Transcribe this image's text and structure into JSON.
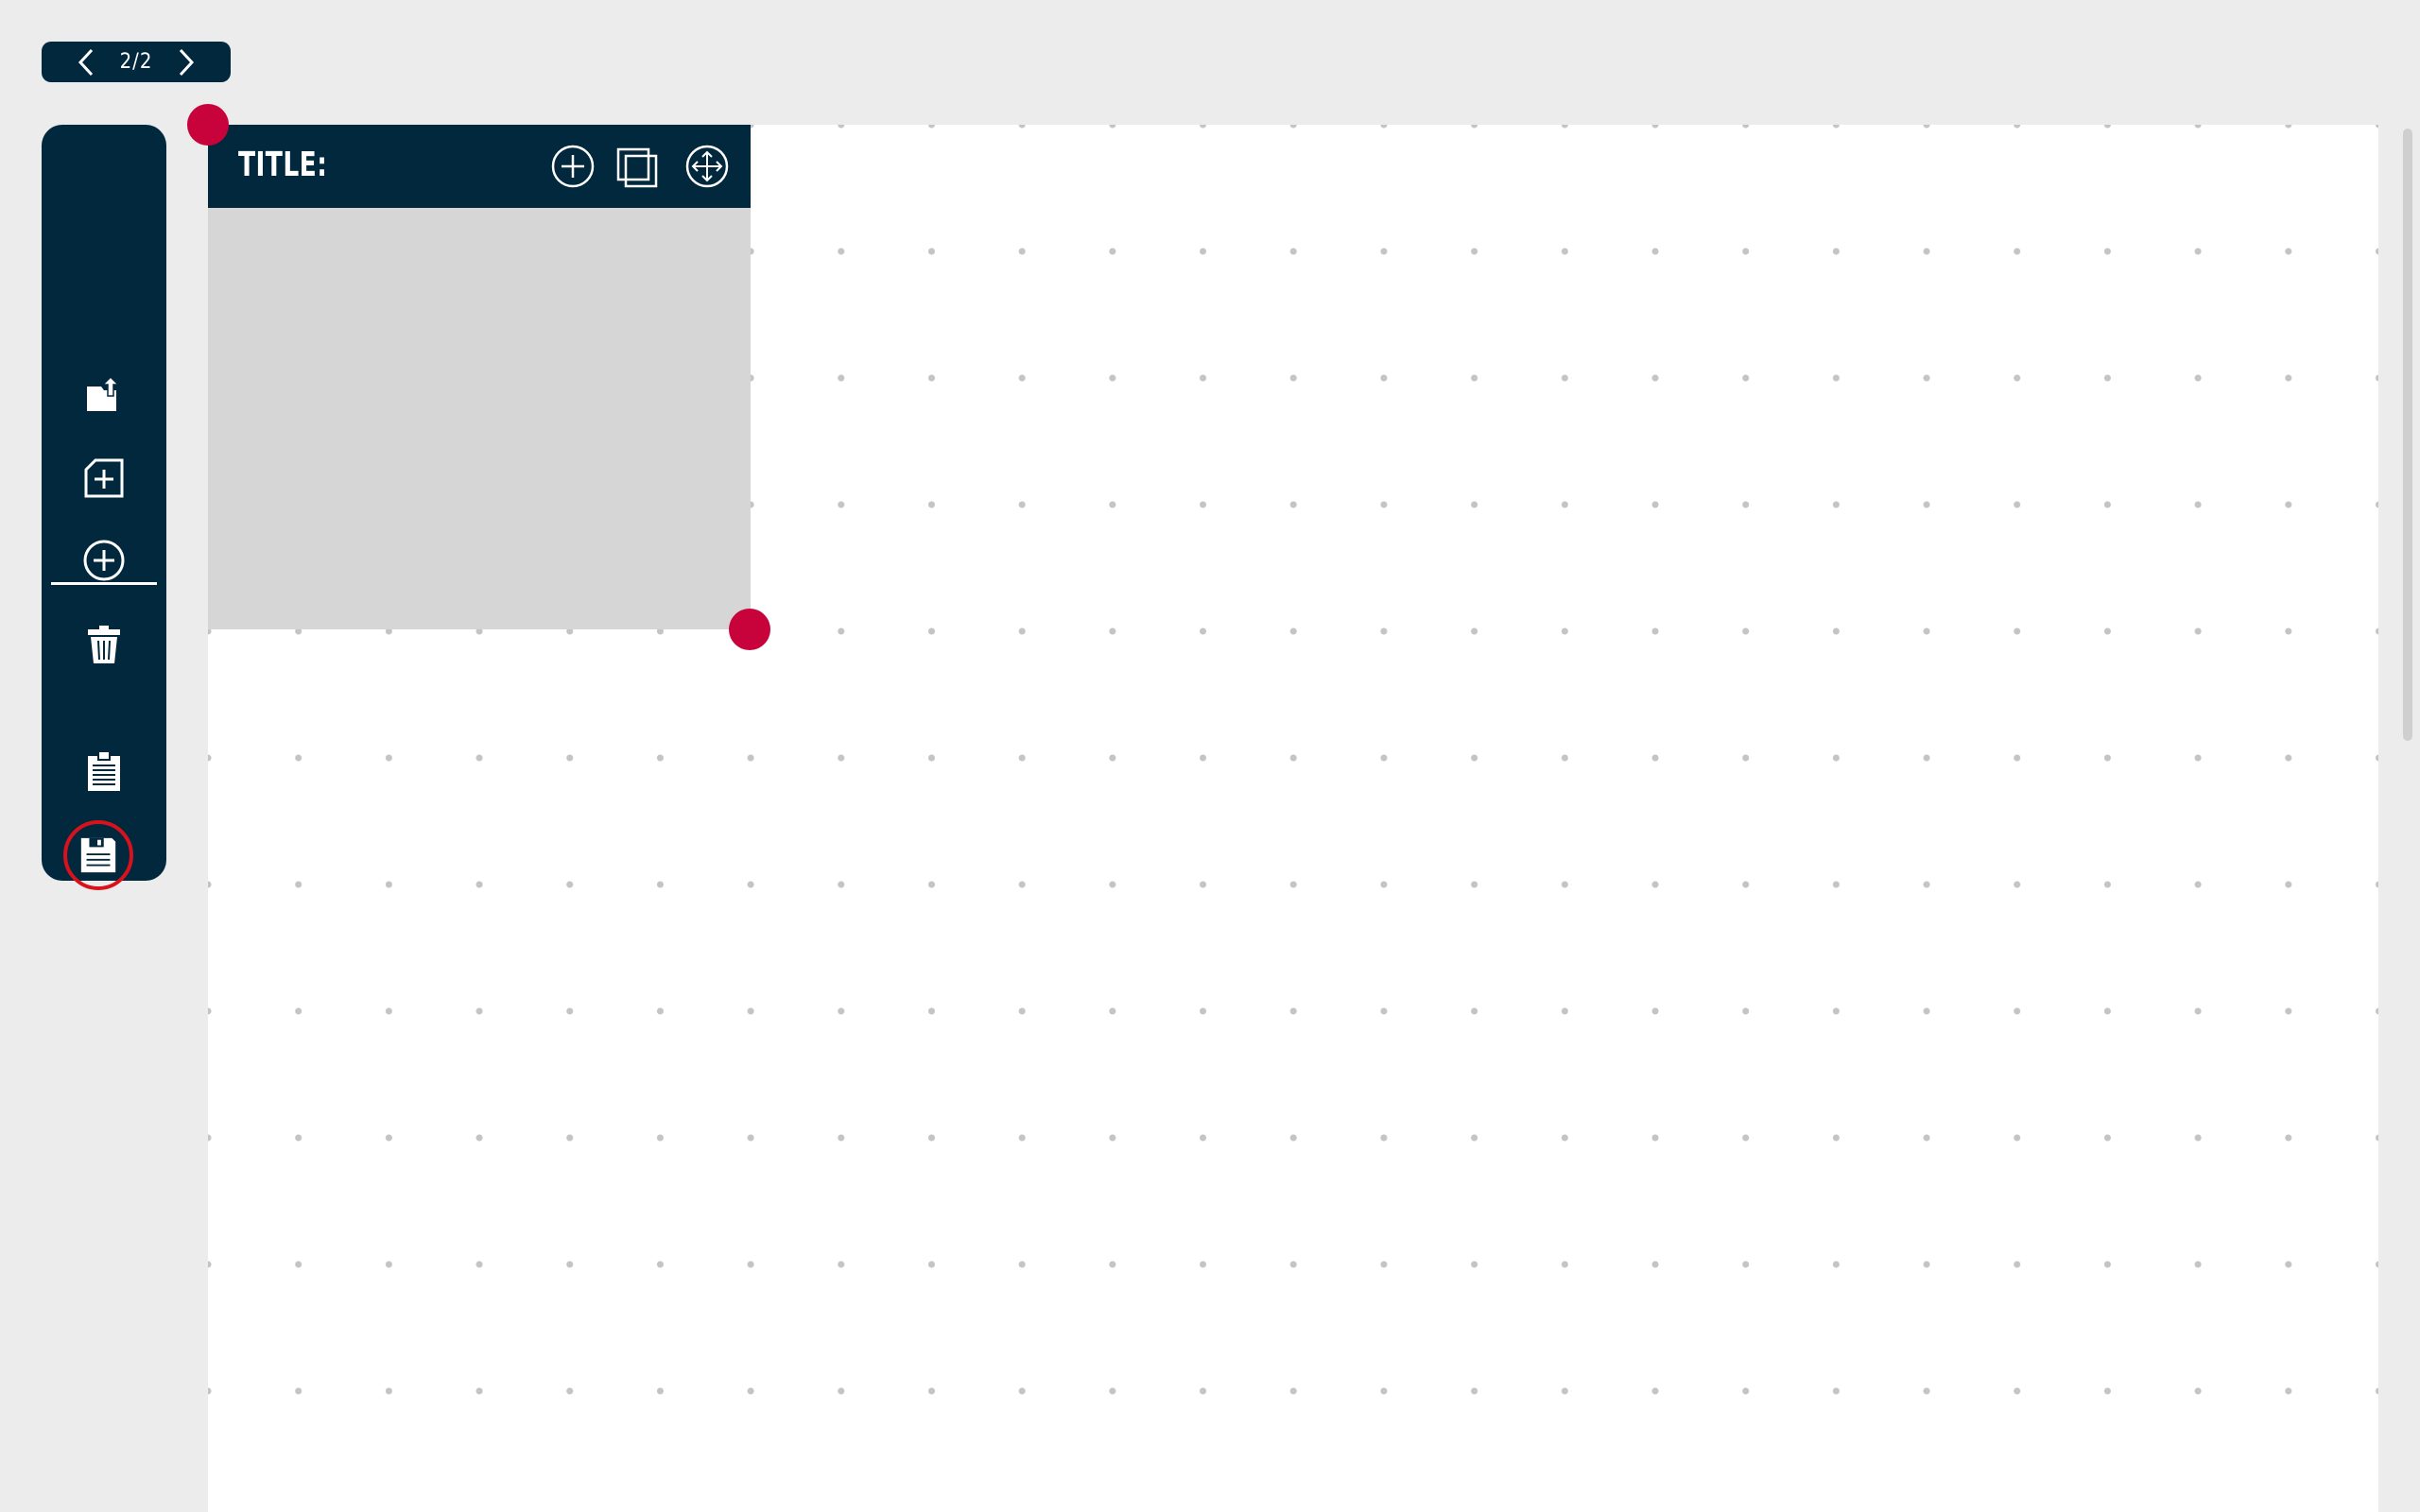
{
  "pager": {
    "count": "2/2",
    "prev_icon": "chevron-left-icon",
    "next_icon": "chevron-right-icon"
  },
  "toolbar": {
    "tools": [
      {
        "name": "export",
        "icon": "share-export-icon"
      },
      {
        "name": "new-page",
        "icon": "add-page-icon"
      },
      {
        "name": "add-element",
        "icon": "plus-circle-icon"
      },
      {
        "name": "delete",
        "icon": "trash-icon"
      },
      {
        "name": "clipboard",
        "icon": "clipboard-icon"
      },
      {
        "name": "save",
        "icon": "floppy-disk-icon",
        "highlighted": true
      }
    ]
  },
  "widget": {
    "title": "TITLE:",
    "buttons": [
      {
        "name": "add",
        "icon": "plus-circle-icon"
      },
      {
        "name": "duplicate",
        "icon": "copy-icon"
      },
      {
        "name": "move",
        "icon": "move-arrows-icon"
      }
    ]
  },
  "colors": {
    "background": "#ececec",
    "panel": "#02283e",
    "canvas": "#ffffff",
    "grid_dot": "#c4c4c4",
    "widget_body": "#d6d6d6",
    "handle": "#c8023a",
    "highlight_ring": "#d8121c"
  }
}
